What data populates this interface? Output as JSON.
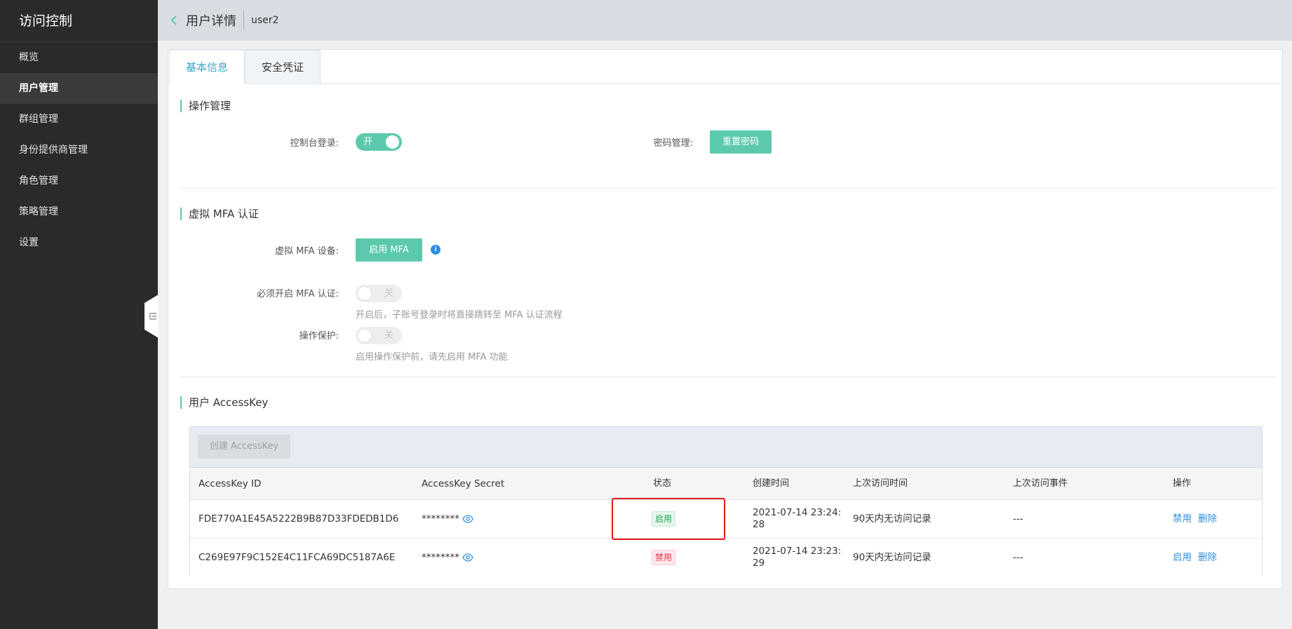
{
  "sidebar": {
    "title": "访问控制",
    "items": [
      {
        "label": "概览"
      },
      {
        "label": "用户管理"
      },
      {
        "label": "群组管理"
      },
      {
        "label": "身份提供商管理"
      },
      {
        "label": "角色管理"
      },
      {
        "label": "策略管理"
      },
      {
        "label": "设置"
      }
    ],
    "active_index": 1
  },
  "header": {
    "title": "用户详情",
    "username": "user2"
  },
  "tabs": [
    {
      "label": "基本信息",
      "active": false
    },
    {
      "label": "安全凭证",
      "active": true
    }
  ],
  "operation": {
    "section_title": "操作管理",
    "console_login_label": "控制台登录:",
    "console_login_toggle": "开",
    "console_login_on": true,
    "password_label": "密码管理:",
    "reset_password_button": "重置密码"
  },
  "mfa": {
    "section_title": "虚拟 MFA 认证",
    "device_label": "虚拟 MFA 设备:",
    "enable_button": "启用 MFA",
    "info_glyph": "i",
    "require_label": "必须开启 MFA 认证:",
    "require_toggle": "关",
    "require_hint": "开启后，子账号登录时将直接跳转至 MFA 认证流程",
    "protect_label": "操作保护:",
    "protect_toggle": "关",
    "protect_hint": "启用操作保护前，请先启用 MFA 功能"
  },
  "accesskey": {
    "section_title": "用户 AccessKey",
    "create_button": "创建 AccessKey",
    "columns": [
      "AccessKey ID",
      "AccessKey Secret",
      "状态",
      "创建时间",
      "上次访问时间",
      "上次访问事件",
      "操作"
    ],
    "rows": [
      {
        "id": "FDE770A1E45A5222B9B87D33FDEDB1D6",
        "secret": "********",
        "status": "启用",
        "created_line1": "2021-07-14 23:24:",
        "created_line2": "28",
        "last_access_time": "90天内无访问记录",
        "last_access_event": "---",
        "action1": "禁用",
        "action2": "删除"
      },
      {
        "id": "C269E97F9C152E4C11FCA69DC5187A6E",
        "secret": "********",
        "status": "禁用",
        "created_line1": "2021-07-14 23:23:",
        "created_line2": "29",
        "last_access_time": "90天内无访问记录",
        "last_access_event": "---",
        "action1": "启用",
        "action2": "删除"
      }
    ]
  },
  "colors": {
    "accent": "#5cc9ad",
    "link": "#2f8ee0",
    "highlight": "#e31b1b",
    "sidebar_bg": "#2a2a2a"
  }
}
